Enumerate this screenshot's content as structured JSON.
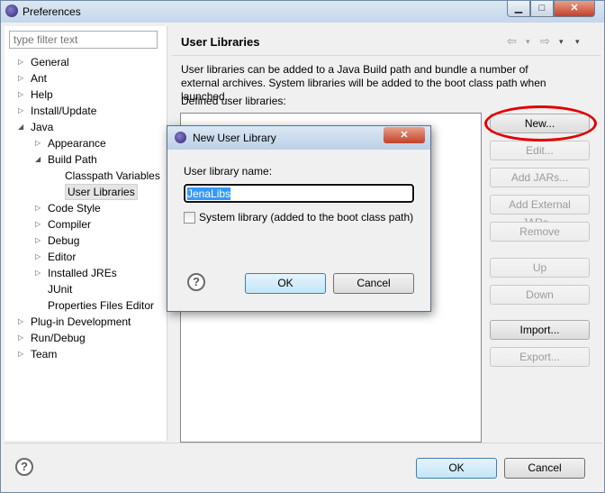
{
  "window": {
    "title": "Preferences",
    "min_glyph": "▁",
    "max_glyph": "□",
    "close_glyph": "✕"
  },
  "filter": {
    "placeholder": "type filter text",
    "value": ""
  },
  "tree": {
    "expanded_glyph": "◢",
    "collapsed_glyph": "▷",
    "items": [
      {
        "label": "General"
      },
      {
        "label": "Ant"
      },
      {
        "label": "Help"
      },
      {
        "label": "Install/Update"
      },
      {
        "label": "Java"
      },
      {
        "label": "Appearance"
      },
      {
        "label": "Build Path"
      },
      {
        "label": "Classpath Variables"
      },
      {
        "label": "User Libraries",
        "selected": true
      },
      {
        "label": "Code Style"
      },
      {
        "label": "Compiler"
      },
      {
        "label": "Debug"
      },
      {
        "label": "Editor"
      },
      {
        "label": "Installed JREs"
      },
      {
        "label": "JUnit"
      },
      {
        "label": "Properties Files Editor"
      },
      {
        "label": "Plug-in Development"
      },
      {
        "label": "Run/Debug"
      },
      {
        "label": "Team"
      }
    ]
  },
  "page": {
    "heading": "User Libraries",
    "nav": {
      "back": "⇦",
      "forward": "⇨",
      "dropdown": "▾",
      "menu": "▾"
    },
    "description": "User libraries can be added to a Java Build path and bundle a number of external archives. System libraries will be added to the boot class path when launched.",
    "defined_label": "Defined user libraries:",
    "buttons": {
      "new": "New...",
      "edit": "Edit...",
      "add_jars": "Add JARs...",
      "add_external_jars": "Add External JARs...",
      "remove": "Remove",
      "up": "Up",
      "down": "Down",
      "import": "Import...",
      "export": "Export..."
    }
  },
  "footer": {
    "help": "?",
    "ok": "OK",
    "cancel": "Cancel"
  },
  "dialog": {
    "title": "New User Library",
    "close_glyph": "✕",
    "name_label": "User library name:",
    "name_value": "JenaLibs",
    "system_label": "System library (added to the boot class path)",
    "system_checked": false,
    "help": "?",
    "ok": "OK",
    "cancel": "Cancel"
  },
  "colors": {
    "highlight_circle": "#e00000",
    "selection": "#3399ff"
  }
}
